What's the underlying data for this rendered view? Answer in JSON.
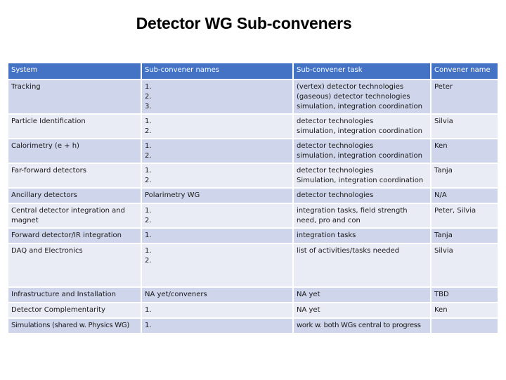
{
  "title": "Detector WG Sub-conveners",
  "table": {
    "headers": [
      "System",
      "Sub-convener names",
      "Sub-convener task",
      "Convener name"
    ],
    "rows": [
      {
        "system": "Tracking",
        "names": [
          "1.",
          "2.",
          "3."
        ],
        "task": [
          "(vertex) detector technologies",
          "(gaseous) detector technologies",
          "simulation, integration coordination"
        ],
        "convener": "Peter"
      },
      {
        "system": "Particle Identification",
        "names": [
          "1.",
          "2."
        ],
        "task": [
          "detector technologies",
          "simulation, integration coordination"
        ],
        "convener": "Silvia"
      },
      {
        "system": "Calorimetry (e + h)",
        "names": [
          "1.",
          "2."
        ],
        "task": [
          "detector technologies",
          "simulation, integration coordination"
        ],
        "convener": "Ken"
      },
      {
        "system": "Far-forward detectors",
        "names": [
          "1.",
          "2."
        ],
        "task": [
          "detector technologies",
          "Simulation, integration coordination"
        ],
        "convener": "Tanja"
      },
      {
        "system": "Ancillary detectors",
        "names": [
          "Polarimetry WG"
        ],
        "task": [
          "detector technologies"
        ],
        "convener": "N/A"
      },
      {
        "system": "Central detector integration and magnet",
        "names": [
          "1.",
          "2."
        ],
        "task": [
          "integration tasks, field strength need, pro and con"
        ],
        "convener": "Peter, Silvia"
      },
      {
        "system": "Forward detector/IR integration",
        "names": [
          "1."
        ],
        "task": [
          "integration tasks"
        ],
        "convener": "Tanja"
      },
      {
        "system": "DAQ and Electronics",
        "names": [
          "1.",
          "2."
        ],
        "task": [
          "list of activities/tasks needed"
        ],
        "convener": "Silvia"
      },
      {
        "system": "Infrastructure and Installation",
        "names": [
          "NA yet/conveners"
        ],
        "task": [
          "NA yet"
        ],
        "convener": "TBD"
      },
      {
        "system": "Detector Complementarity",
        "names": [
          "1."
        ],
        "task": [
          "NA yet"
        ],
        "convener": "Ken"
      },
      {
        "system": "Simulations (shared w. Physics WG)",
        "names": [
          "1."
        ],
        "task": [
          "work w. both WGs central to progress"
        ],
        "convener": ""
      }
    ]
  },
  "colors": {
    "header_bg": "#4472c4",
    "row_odd_bg": "#cfd5ea",
    "row_even_bg": "#e9ebf5"
  }
}
